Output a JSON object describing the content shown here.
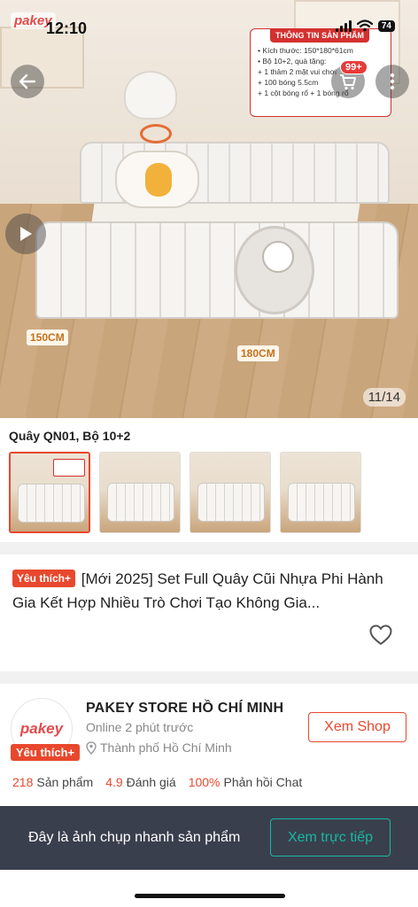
{
  "status_bar": {
    "time": "12:10",
    "battery": "74"
  },
  "hero": {
    "logo_text": "pakey",
    "cart_badge": "99+",
    "image_counter": "11/14",
    "dimension_width": "150CM",
    "dimension_length": "180CM",
    "info_card": {
      "title": "THÔNG TIN SẢN PHẨM",
      "lines": [
        "• Kích thước: 150*180*61cm",
        "• Bộ 10+2, quà tặng:",
        "   + 1 thảm 2 mặt vui chơi",
        "   + 100 bóng 5.5cm",
        "   + 1 cột bóng rổ + 1 bóng rổ"
      ]
    }
  },
  "variant": {
    "label": "Quây QN01, Bộ 10+2",
    "thumbnails": [
      "variant-1",
      "variant-2",
      "variant-3",
      "variant-4"
    ],
    "selected_index": 0
  },
  "product": {
    "fav_tag": "Yêu thích+",
    "title": "[Mới 2025] Set Full Quây Cũi Nhựa Phi Hành Gia Kết Hợp Nhiều Trò Chơi Tạo Không Gia..."
  },
  "shop": {
    "logo_text": "pakey",
    "fav_tag": "Yêu thích+",
    "name": "PAKEY STORE HỒ CHÍ MINH",
    "online": "Online 2 phút trước",
    "location": "Thành phố Hồ Chí Minh",
    "view_button": "Xem Shop",
    "stats": {
      "products_value": "218",
      "products_label": "Sản phẩm",
      "rating_value": "4.9",
      "rating_label": "Đánh giá",
      "response_value": "100%",
      "response_label": "Phản hồi Chat"
    }
  },
  "snapshot": {
    "text": "Đây là ảnh chụp nhanh sản phẩm",
    "button": "Xem trực tiếp"
  },
  "colors": {
    "accent": "#e8482d",
    "teal": "#16b9a3",
    "banner": "#3a3f4d"
  }
}
